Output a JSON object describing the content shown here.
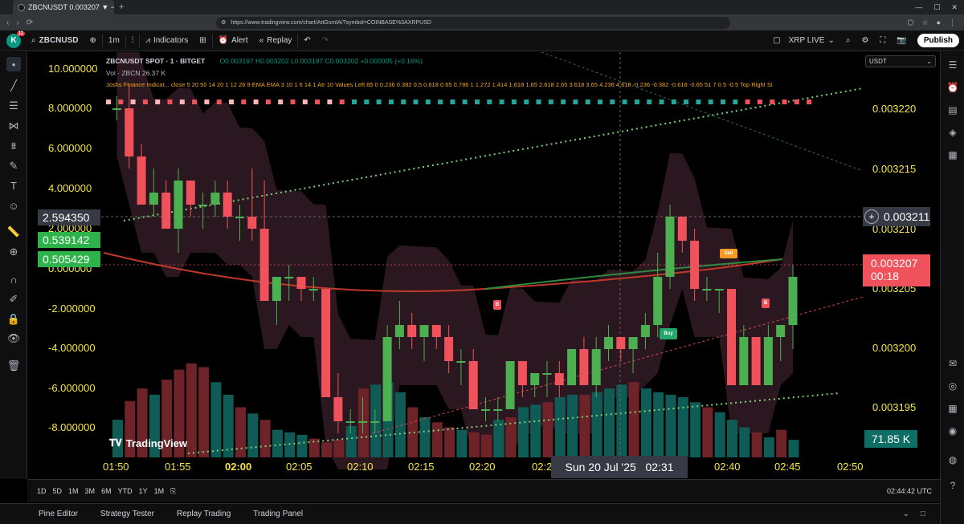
{
  "browser": {
    "tab_title": "ZBCNUSDT 0.003207 ▼ −0.5% …",
    "url": "https://www.tradingview.com/chart/AttGsmIA/?symbol=COINBASE%3AXRPUSD"
  },
  "header": {
    "avatar_letter": "K",
    "avatar_badge": "11",
    "symbol": "ZBCNUSD",
    "interval": "1m",
    "indicators_label": "Indicators",
    "alert_label": "Alert",
    "replay_label": "Replay",
    "layout_name": "XRP LIVE",
    "publish_label": "Publish"
  },
  "legend": {
    "title": "ZBCNUSDT SPOT · 1 · BITGET",
    "ohlc": "O0.003197 H0.003202 L0.003197 C0.003202 +0.000005 (+0.16%)",
    "vol": "Vol · ZBCN  26.37 K",
    "indicator": "Joshs Finance Indicat... close 5 20 50 14 20 1 12 26 9 EMA EMA 3 10 1 6 14 1 Atr 10 Values Left 85 0 0.236 0.382 0.5 0.618 0.65 0.786 1 1.272 1.414 1.618 1.65 2.618 2.65 3.618 3.65 4.236 4.618 -0.236 -0.382 -0.618 -0.65 51 7 0.5 -0.5 Top Right Si"
  },
  "currency_select": "USDT",
  "left_axis": [
    "10.000000",
    "8.000000",
    "6.000000",
    "4.000000",
    "2.000000",
    "0.000000",
    "-2.000000",
    "-4.000000",
    "-6.000000",
    "-8.000000"
  ],
  "left_labels": [
    "2.594350",
    "0.539142",
    "0.505429"
  ],
  "right_axis": [
    "0.003220",
    "0.003215",
    "0.003210",
    "0.003205",
    "0.003200",
    "0.003195"
  ],
  "right_labels": {
    "crosshair": "0.003211",
    "last_price": "0.003207",
    "countdown": "00:18",
    "volume": "71.85 K"
  },
  "time_axis": [
    "01:50",
    "01:55",
    "02:00",
    "02:05",
    "02:10",
    "02:15",
    "02:20",
    "02:2",
    "02:40",
    "02:45",
    "02:50"
  ],
  "crosshair_time": "Sun 20 Jul '25   02:31",
  "signals": {
    "buy": "Buy",
    "sell": "Sell",
    "b": "B"
  },
  "watermark": "TradingView",
  "ranges": [
    "1D",
    "5D",
    "1M",
    "3M",
    "6M",
    "YTD",
    "1Y",
    "1M"
  ],
  "clock": "02:44:42 UTC",
  "panel_tabs": [
    "Pine Editor",
    "Strategy Tester",
    "Replay Trading",
    "Trading Panel"
  ],
  "colors": {
    "up": "#4caf50",
    "down": "#f0525b",
    "axis_text": "#f5e642",
    "vol_up": "#0e5c55",
    "vol_down": "#6d2327"
  },
  "chart_data": {
    "type": "candlestick",
    "price_range": [
      0.003192,
      0.003225
    ],
    "candles": [
      [
        0.003221,
        0.003222,
        0.00322,
        0.003221
      ],
      [
        0.003221,
        0.003223,
        0.003216,
        0.003217
      ],
      [
        0.003217,
        0.003218,
        0.003213,
        0.003213
      ],
      [
        0.003213,
        0.003216,
        0.003212,
        0.003214
      ],
      [
        0.003214,
        0.003215,
        0.003211,
        0.003211
      ],
      [
        0.003211,
        0.003216,
        0.003209,
        0.003215
      ],
      [
        0.003215,
        0.003215,
        0.003212,
        0.003213
      ],
      [
        0.003213,
        0.003214,
        0.003211,
        0.003213
      ],
      [
        0.003213,
        0.003215,
        0.003212,
        0.003214
      ],
      [
        0.003214,
        0.003215,
        0.003211,
        0.003212
      ],
      [
        0.003212,
        0.003213,
        0.00321,
        0.003212
      ],
      [
        0.003212,
        0.003216,
        0.00321,
        0.003211
      ],
      [
        0.003211,
        0.003215,
        0.003205,
        0.003205
      ],
      [
        0.003205,
        0.003207,
        0.003203,
        0.003207
      ],
      [
        0.003207,
        0.003208,
        0.003205,
        0.003207
      ],
      [
        0.003207,
        0.003207,
        0.003205,
        0.003206
      ],
      [
        0.003206,
        0.003207,
        0.003205,
        0.003206
      ],
      [
        0.003206,
        0.003206,
        0.003198,
        0.003197
      ],
      [
        0.003197,
        0.003199,
        0.003194,
        0.003195
      ],
      [
        0.003195,
        0.003196,
        0.003194,
        0.003195
      ],
      [
        0.003195,
        0.003197,
        0.003194,
        0.003195
      ],
      [
        0.003195,
        0.003196,
        0.003194,
        0.003195
      ],
      [
        0.003195,
        0.003203,
        0.003195,
        0.003202
      ],
      [
        0.003202,
        0.003205,
        0.003201,
        0.003203
      ],
      [
        0.003203,
        0.003204,
        0.003201,
        0.003202
      ],
      [
        0.003202,
        0.003203,
        0.0032,
        0.003203
      ],
      [
        0.003203,
        0.003203,
        0.003201,
        0.003202
      ],
      [
        0.003202,
        0.003203,
        0.003199,
        0.0032
      ],
      [
        0.0032,
        0.003201,
        0.003198,
        0.0032
      ],
      [
        0.0032,
        0.003201,
        0.003196,
        0.003196
      ],
      [
        0.003196,
        0.003197,
        0.003195,
        0.003196
      ],
      [
        0.003196,
        0.003197,
        0.003195,
        0.003196
      ],
      [
        0.003196,
        0.0032,
        0.003196,
        0.0032
      ],
      [
        0.0032,
        0.0032,
        0.003197,
        0.003198
      ],
      [
        0.003198,
        0.003199,
        0.003197,
        0.003199
      ],
      [
        0.003199,
        0.0032,
        0.003197,
        0.003199
      ],
      [
        0.003199,
        0.0032,
        0.003197,
        0.003198
      ],
      [
        0.003198,
        0.003201,
        0.003198,
        0.003201
      ],
      [
        0.003201,
        0.003202,
        0.003198,
        0.003198
      ],
      [
        0.003198,
        0.003202,
        0.003197,
        0.003201
      ],
      [
        0.003201,
        0.003203,
        0.0032,
        0.003202
      ],
      [
        0.003202,
        0.003202,
        0.0032,
        0.003201
      ],
      [
        0.003201,
        0.003202,
        0.003199,
        0.003202
      ],
      [
        0.003202,
        0.003204,
        0.003201,
        0.003203
      ],
      [
        0.003203,
        0.003209,
        0.003202,
        0.003207
      ],
      [
        0.003207,
        0.003213,
        0.003206,
        0.003212
      ],
      [
        0.003212,
        0.003212,
        0.003209,
        0.00321
      ],
      [
        0.00321,
        0.003211,
        0.003205,
        0.003206
      ],
      [
        0.003206,
        0.003207,
        0.003205,
        0.003206
      ],
      [
        0.003206,
        0.003206,
        0.003204,
        0.003206
      ],
      [
        0.003206,
        0.003206,
        0.003198,
        0.003198
      ],
      [
        0.003198,
        0.003203,
        0.003198,
        0.003202
      ],
      [
        0.003202,
        0.003202,
        0.003198,
        0.003198
      ],
      [
        0.003198,
        0.003203,
        0.003198,
        0.003202
      ],
      [
        0.003202,
        0.003203,
        0.0032,
        0.003203
      ],
      [
        0.003203,
        0.003208,
        0.003201,
        0.003207
      ]
    ],
    "volume": [
      30,
      45,
      55,
      50,
      62,
      70,
      75,
      72,
      60,
      50,
      40,
      35,
      30,
      22,
      20,
      18,
      15,
      12,
      14,
      25,
      55,
      58,
      60,
      52,
      40,
      32,
      28,
      24,
      22,
      20,
      18,
      30,
      32,
      40,
      42,
      44,
      48,
      50,
      50,
      52,
      55,
      58,
      60,
      55,
      52,
      50,
      48,
      44,
      40,
      36,
      30,
      24,
      20,
      16,
      22,
      14
    ],
    "volume_up": [
      true,
      false,
      false,
      true,
      false,
      false,
      false,
      false,
      true,
      true,
      false,
      true,
      false,
      true,
      true,
      true,
      false,
      false,
      false,
      true,
      false,
      true,
      true,
      true,
      false,
      true,
      false,
      false,
      true,
      false,
      false,
      true,
      false,
      true,
      true,
      false,
      true,
      true,
      false,
      true,
      true,
      true,
      false,
      true,
      true,
      true,
      true,
      true,
      false,
      true,
      true,
      true,
      false,
      true,
      false,
      true
    ]
  }
}
